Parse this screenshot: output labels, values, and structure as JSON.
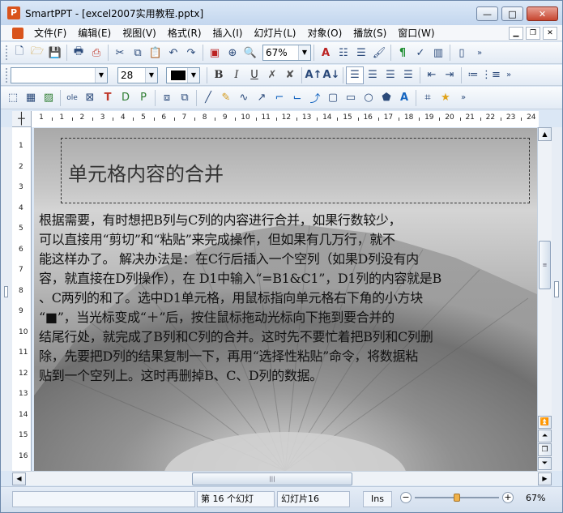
{
  "window": {
    "title": "SmartPPT - [excel2007实用教程.pptx]",
    "icon_letter": "P",
    "minimize": "—",
    "maximize": "□",
    "close": "✕"
  },
  "menu": [
    "文件(F)",
    "编辑(E)",
    "视图(V)",
    "格式(R)",
    "插入(I)",
    "幻灯片(L)",
    "对象(O)",
    "播放(S)",
    "窗口(W)"
  ],
  "toolbar": {
    "zoom_value": "67%",
    "font_value": "",
    "font_size": "28",
    "bold": "B",
    "italic": "I",
    "underline": "U"
  },
  "ruler": {
    "h_numbers": [
      "1",
      "1",
      "2",
      "3",
      "4",
      "5",
      "6",
      "7",
      "8",
      "9",
      "10",
      "11",
      "12",
      "13",
      "14",
      "15",
      "16",
      "17",
      "18",
      "19",
      "20",
      "21",
      "22",
      "23",
      "24"
    ],
    "v_numbers": [
      "1",
      "2",
      "3",
      "4",
      "5",
      "6",
      "7",
      "8",
      "9",
      "10",
      "11",
      "12",
      "13",
      "14",
      "15",
      "16"
    ]
  },
  "slide": {
    "title": "单元格内容的合并",
    "body_lines": [
      "根据需要，有时想把B列与C列的内容进行合并，如果行数较少，",
      "可以直接用“剪切”和“粘贴”来完成操作，但如果有几万行，就不",
      "能这样办了。 解决办法是：在C行后插入一个空列（如果D列没有内",
      "容，就直接在D列操作），在 D1中输入“=B1&C1”，D1列的内容就是B",
      "、C两列的和了。选中D1单元格，用鼠标指向单元格右下角的小方块",
      "“■”，当光标变成“＋”后，按住鼠标拖动光标向下拖到要合并的",
      "结尾行处，就完成了B列和C列的合并。这时先不要忙着把B列和C列删",
      "除，先要把D列的结果复制一下，再用“选择性粘贴”命令，将数据粘",
      "贴到一个空列上。这时再删掉B、C、D列的数据。"
    ]
  },
  "status": {
    "slide_count": "第 16 个幻灯",
    "current_slide": "幻灯片16",
    "mode": "Ins",
    "zoom_pct": "67%",
    "zoom_level": 0.5
  }
}
